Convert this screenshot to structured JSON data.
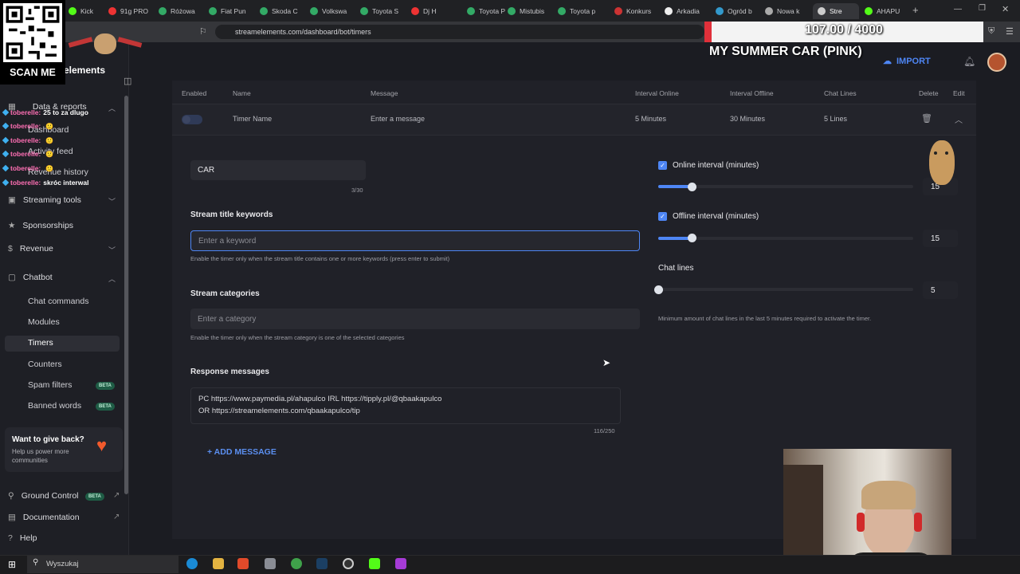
{
  "browser": {
    "tabs": [
      "Kick",
      "91g PRO",
      "Różowa",
      "Fiat Pun",
      "Skoda C",
      "Volkswa",
      "Toyota S",
      "Dj H",
      "Toyota P",
      "Mistubis",
      "Toyota p",
      "Konkurs",
      "Arkadia",
      "Ogród b",
      "Nowa k",
      "Stre",
      "AHAPU"
    ],
    "url": "streamelements.com/dashboard/bot/timers"
  },
  "sidebar": {
    "brand": "elements",
    "data_reports": "Data & reports",
    "dashboard": "Dashboard",
    "activity_feed": "Activity feed",
    "revenue_history": "Revenue history",
    "streaming_tools": "Streaming tools",
    "sponsorships": "Sponsorships",
    "revenue": "Revenue",
    "chatbot": "Chatbot",
    "chatbot_items": [
      "Chat commands",
      "Modules",
      "Timers",
      "Counters",
      "Spam filters",
      "Banned words"
    ],
    "beta": "BETA",
    "give_title": "Want to give back?",
    "give_text": "Help us power more communities",
    "ground_control": "Ground Control",
    "documentation": "Documentation",
    "help": "Help"
  },
  "header": {
    "import": "IMPORT"
  },
  "table": {
    "headers": [
      "Enabled",
      "Name",
      "Message",
      "Interval Online",
      "Interval Offline",
      "Chat Lines",
      "Delete",
      "Edit"
    ],
    "row": {
      "name": "Timer Name",
      "message": "Enter a message",
      "interval_online": "5 Minutes",
      "interval_offline": "30 Minutes",
      "chat_lines": "5 Lines"
    }
  },
  "form": {
    "name_value": "CAR",
    "name_count": "3/30",
    "keywords_label": "Stream title keywords",
    "keywords_placeholder": "Enter a keyword",
    "keywords_hint": "Enable the timer only when the stream title contains one or more keywords (press enter to submit)",
    "categories_label": "Stream categories",
    "categories_placeholder": "Enter a category",
    "categories_hint": "Enable the timer only when the stream category is one of the selected categories",
    "response_label": "Response messages",
    "response_text": "PC https://www.paymedia.pl/ahapulco IRL https://tipply.pl/@qbaakapulco\nOR https://streamelements.com/qbaakapulco/tip",
    "response_count": "116/250",
    "add_message": "+ ADD MESSAGE",
    "online_label": "Online interval (minutes)",
    "online_value": "15",
    "online_fraction": 0.13,
    "offline_label": "Offline interval (minutes)",
    "offline_value": "15",
    "offline_fraction": 0.13,
    "chat_lines_label": "Chat lines",
    "chat_lines_value": "5",
    "chat_lines_fraction": 0.0,
    "chat_lines_hint": "Minimum amount of chat lines in the last 5 minutes required to activate the timer."
  },
  "overlay": {
    "scan_me": "SCAN ME",
    "goal": "107.00 / 4000",
    "goal_fraction": 0.027,
    "goal_title": "MY SUMMER CAR (PINK)",
    "chat": [
      {
        "user": "toberelle:",
        "msg": "25 to za dlugo"
      },
      {
        "user": "toberelle:",
        "msg": ""
      },
      {
        "user": "toberelle:",
        "msg": ""
      },
      {
        "user": "toberelle:",
        "msg": ""
      },
      {
        "user": "toberelle:",
        "msg": ""
      },
      {
        "user": "toberelle:",
        "msg": "skróc interwal"
      }
    ]
  },
  "taskbar": {
    "search": "Wyszukaj"
  },
  "colors": {
    "accent": "#4e86f5",
    "beta": "#1f5d46",
    "goal_fill": "#e0303a"
  }
}
